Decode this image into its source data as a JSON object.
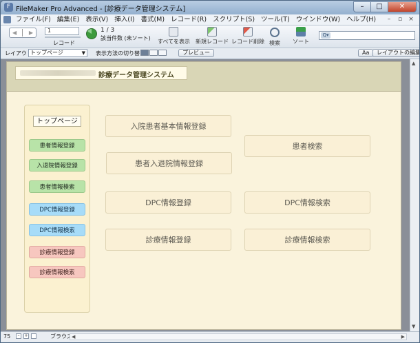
{
  "window": {
    "title": "FileMaker Pro Advanced - [診療データ管理システム]",
    "app_icon": "filemaker-icon",
    "buttons": [
      "–",
      "□",
      "✕"
    ]
  },
  "menu": {
    "items": [
      "ファイル(F)",
      "編集(E)",
      "表示(V)",
      "挿入(I)",
      "書式(M)",
      "レコード(R)",
      "スクリプト(S)",
      "ツール(T)",
      "ウインドウ(W)",
      "ヘルプ(H)"
    ],
    "mdi": [
      "–",
      "▫",
      "×"
    ]
  },
  "toolbar": {
    "record_field": "1",
    "record_label": "レコード",
    "count_main": "1 / 3",
    "count_sub": "該当件数 (未ソート)",
    "show_all": "すべてを表示",
    "new_record": "新規レコード",
    "delete_record": "レコード削除",
    "find": "検索",
    "sort": "ソート"
  },
  "layoutbar": {
    "layout_label": "レイアウト:",
    "layout_value": "トップページ",
    "view_label": "表示方法の切り替え:",
    "preview": "プレビュー",
    "aa": "Aa",
    "edit_layout": "レイアウトの編集"
  },
  "form": {
    "system_title": "診療データ管理システム",
    "top_page_label": "トップページ",
    "side_buttons": [
      {
        "label": "患者情報登録",
        "color": "green"
      },
      {
        "label": "入退院情報登録",
        "color": "green"
      },
      {
        "label": "患者情報検索",
        "color": "green"
      },
      {
        "label": "DPC情報登録",
        "color": "blue"
      },
      {
        "label": "DPC情報検索",
        "color": "blue"
      },
      {
        "label": "診療情報登録",
        "color": "pink"
      },
      {
        "label": "診療情報検索",
        "color": "pink"
      }
    ],
    "main_buttons": {
      "admit_basic": "入院患者基本情報登録",
      "patient_search": "患者検索",
      "admit_discharge": "患者入退院情報登録",
      "dpc_register": "DPC情報登録",
      "dpc_search": "DPC情報検索",
      "clinical_register": "診療情報登録",
      "clinical_search": "診療情報検索"
    }
  },
  "statusbar": {
    "zoom": "75",
    "mode": "ブラウズ"
  }
}
